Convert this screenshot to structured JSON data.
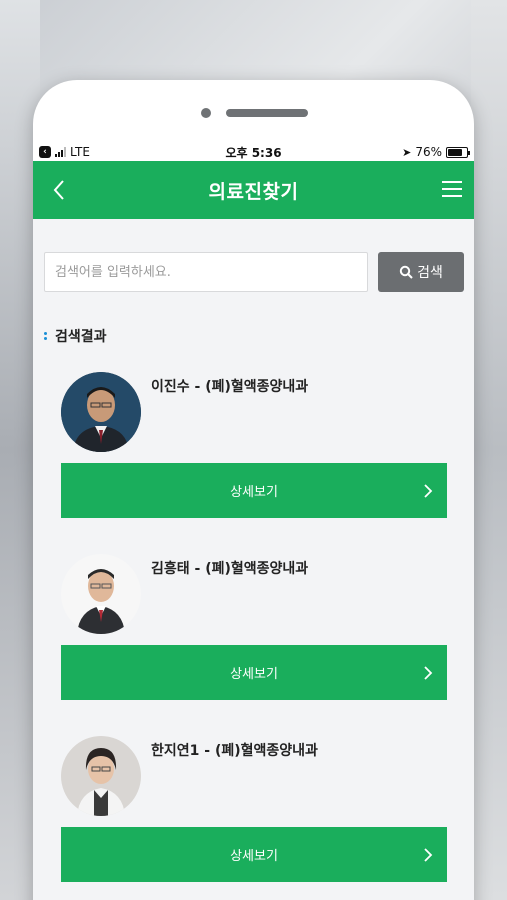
{
  "status_bar": {
    "carrier": "LTE",
    "time": "오후 5:36",
    "battery": "76%",
    "battery_level": 0.76
  },
  "header": {
    "title": "의료진찾기"
  },
  "search": {
    "placeholder": "검색어를 입력하세요.",
    "value": "",
    "button_label": "검색"
  },
  "results": {
    "heading": "검색결과",
    "detail_label": "상세보기",
    "doctors": [
      {
        "name": "이진수 - (폐)혈액종양내과"
      },
      {
        "name": "김흥태 - (폐)혈액종양내과"
      },
      {
        "name": "한지연1 - (폐)혈액종양내과"
      }
    ]
  },
  "colors": {
    "accent": "#1aae5c",
    "search_button": "#6b6e71"
  }
}
